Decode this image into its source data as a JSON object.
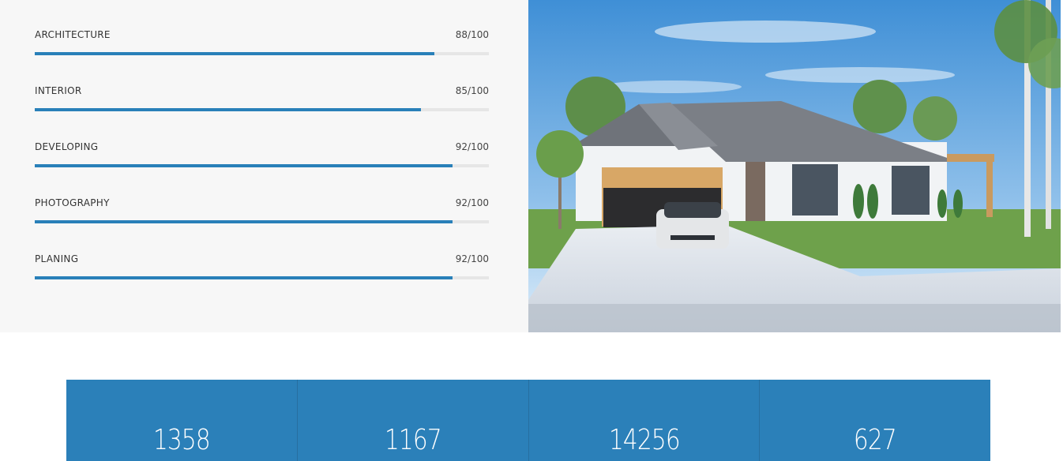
{
  "skills": [
    {
      "label": "ARCHITECTURE",
      "value_text": "88/100",
      "value": 88
    },
    {
      "label": "INTERIOR",
      "value_text": "85/100",
      "value": 85
    },
    {
      "label": "DEVELOPING",
      "value_text": "92/100",
      "value": 92
    },
    {
      "label": "PHOTOGRAPHY",
      "value_text": "92/100",
      "value": 92
    },
    {
      "label": "PLANING",
      "value_text": "92/100",
      "value": 92
    }
  ],
  "counters": [
    {
      "number": "1358"
    },
    {
      "number": "1167"
    },
    {
      "number": "14256"
    },
    {
      "number": "627"
    }
  ],
  "colors": {
    "accent": "#2980b9",
    "track": "#e6e6e6",
    "panel_bg": "#f7f7f7",
    "counter_bg": "#2b80b9"
  },
  "image": {
    "icon": "house-photo"
  }
}
